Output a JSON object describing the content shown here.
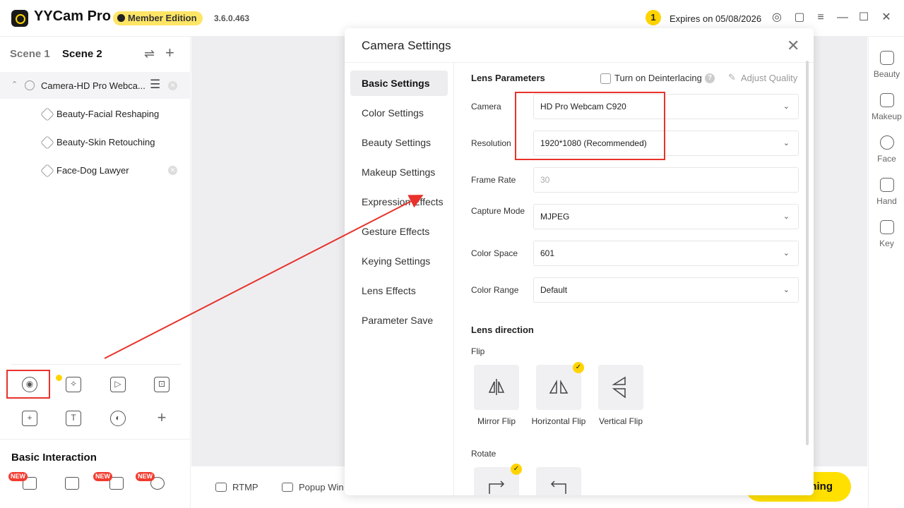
{
  "titlebar": {
    "app_name": "YYCam Pro",
    "edition": "Member Edition",
    "version": "3.6.0.463",
    "notification_count": "1",
    "expires": "Expires on 05/08/2026"
  },
  "scenes": {
    "tabs": [
      "Scene 1",
      "Scene 2"
    ],
    "active": "Scene 2"
  },
  "sources": {
    "camera": "Camera-HD Pro Webca...",
    "children": [
      "Beauty-Facial Reshaping",
      "Beauty-Skin Retouching",
      "Face-Dog Lawyer"
    ]
  },
  "basic_interaction": {
    "title": "Basic Interaction",
    "new_badge": "NEW"
  },
  "bottombar": {
    "rtmp": "RTMP",
    "popup": "Popup Win",
    "start": "ming"
  },
  "rightbar": {
    "items": [
      "Beauty",
      "Makeup",
      "Face",
      "Hand",
      "Key"
    ]
  },
  "dialog": {
    "title": "Camera Settings",
    "nav": [
      "Basic Settings",
      "Color Settings",
      "Beauty Settings",
      "Makeup Settings",
      "Expression Effects",
      "Gesture Effects",
      "Keying Settings",
      "Lens Effects",
      "Parameter Save"
    ],
    "active_nav": "Basic Settings",
    "lens_parameters": "Lens Parameters",
    "deinterlacing": "Turn on Deinterlacing",
    "adjust_quality": "Adjust Quality",
    "fields": {
      "camera": {
        "label": "Camera",
        "value": "HD Pro Webcam C920"
      },
      "resolution": {
        "label": "Resolution",
        "value": "1920*1080 (Recommended)"
      },
      "frame_rate": {
        "label": "Frame Rate",
        "value": "30"
      },
      "capture_mode": {
        "label": "Capture Mode",
        "value": "MJPEG"
      },
      "color_space": {
        "label": "Color Space",
        "value": "601"
      },
      "color_range": {
        "label": "Color Range",
        "value": "Default"
      }
    },
    "lens_direction": "Lens direction",
    "flip": "Flip",
    "flip_options": [
      "Mirror Flip",
      "Horizontal Flip",
      "Vertical Flip"
    ],
    "rotate": "Rotate"
  },
  "colors": {
    "accent": "#ffd400",
    "annotation_red": "#e8322b"
  }
}
